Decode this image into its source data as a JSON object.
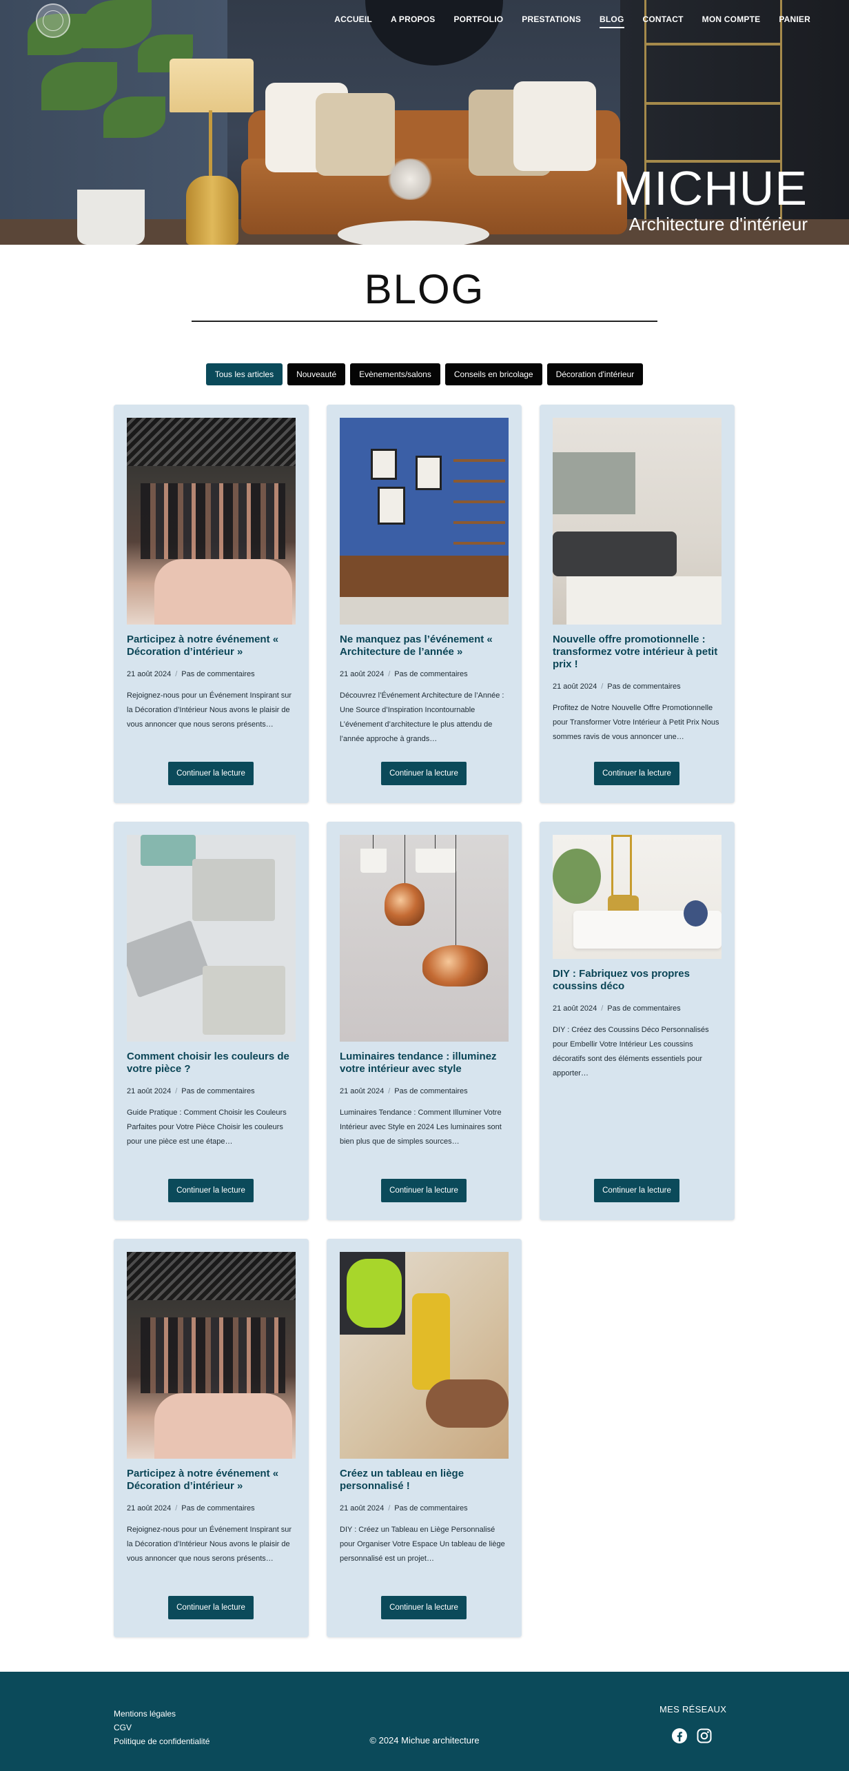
{
  "nav": {
    "items": [
      "ACCUEIL",
      "A PROPOS",
      "PORTFOLIO",
      "PRESTATIONS",
      "BLOG",
      "CONTACT",
      "MON COMPTE",
      "PANIER"
    ]
  },
  "brand": {
    "name": "MICHUE",
    "tagline": "Architecture d'intérieur"
  },
  "page": {
    "title": "BLOG"
  },
  "filters": [
    "Tous les articles",
    "Nouveauté",
    "Evènements/salons",
    "Conseils en bricolage",
    "Décoration d'intérieur"
  ],
  "posts": [
    {
      "title": "Participez à notre événement « Décoration d’intérieur »",
      "date": "21 août 2024",
      "comments": "Pas de commentaires",
      "excerpt": "Rejoignez-nous pour un Événement Inspirant sur la Décoration d’Intérieur Nous avons le plaisir de vous annoncer que nous serons présents…",
      "button": "Continuer la lecture",
      "image": "event-crowd-photo"
    },
    {
      "title": "Ne manquez pas l’événement « Architecture de l’année »",
      "date": "21 août 2024",
      "comments": "Pas de commentaires",
      "excerpt": "Découvrez l’Événement Architecture de l’Année : Une Source d’Inspiration Incontournable L’événement d’architecture le plus attendu de l’année approche à grands…",
      "button": "Continuer la lecture",
      "image": "blue-office-photo"
    },
    {
      "title": "Nouvelle offre promotionnelle : transformez votre intérieur à petit prix !",
      "date": "21 août 2024",
      "comments": "Pas de commentaires",
      "excerpt": "Profitez de Notre Nouvelle Offre Promotionnelle pour Transformer Votre Intérieur à Petit Prix Nous sommes ravis de vous annoncer une…",
      "button": "Continuer la lecture",
      "image": "living-room-photo"
    },
    {
      "title": "Comment choisir les couleurs de votre pièce ?",
      "date": "21 août 2024",
      "comments": "Pas de commentaires",
      "excerpt": "Guide Pratique : Comment Choisir les Couleurs Parfaites pour Votre Pièce Choisir les couleurs pour une pièce est une étape…",
      "button": "Continuer la lecture",
      "image": "color-swatches-photo"
    },
    {
      "title": "Luminaires tendance : illuminez votre intérieur avec style",
      "date": "21 août 2024",
      "comments": "Pas de commentaires",
      "excerpt": "Luminaires Tendance : Comment Illuminer Votre Intérieur avec Style en 2024 Les luminaires sont bien plus que de simples sources…",
      "button": "Continuer la lecture",
      "image": "pendant-lamps-photo"
    },
    {
      "title": "DIY : Fabriquez vos propres coussins déco",
      "date": "21 août 2024",
      "comments": "Pas de commentaires",
      "excerpt": "DIY : Créez des Coussins Déco Personnalisés pour Embellir Votre Intérieur Les coussins décoratifs sont des éléments essentiels pour apporter…",
      "button": "Continuer la lecture",
      "image": "cushions-photo"
    },
    {
      "title": "Participez à notre événement « Décoration d’intérieur »",
      "date": "21 août 2024",
      "comments": "Pas de commentaires",
      "excerpt": "Rejoignez-nous pour un Événement Inspirant sur la Décoration d’Intérieur Nous avons le plaisir de vous annoncer que nous serons présents…",
      "button": "Continuer la lecture",
      "image": "event-crowd-photo"
    },
    {
      "title": "Créez un tableau en liège personnalisé !",
      "date": "21 août 2024",
      "comments": "Pas de commentaires",
      "excerpt": "DIY : Créez un Tableau en Liège Personnalisé pour Organiser Votre Espace Un tableau de liège personnalisé est un projet…",
      "button": "Continuer la lecture",
      "image": "drill-photo"
    }
  ],
  "footer": {
    "links": [
      "Mentions légales",
      "CGV",
      "Politique de confidentialité"
    ],
    "copyright": "© 2024 Michue architecture",
    "social_title": "MES RÉSEAUX",
    "social_icons": [
      "facebook-icon",
      "instagram-icon"
    ]
  },
  "colors": {
    "accent": "#0b4a5a",
    "card_bg": "#d7e4ee",
    "filter_bg": "#050505"
  }
}
